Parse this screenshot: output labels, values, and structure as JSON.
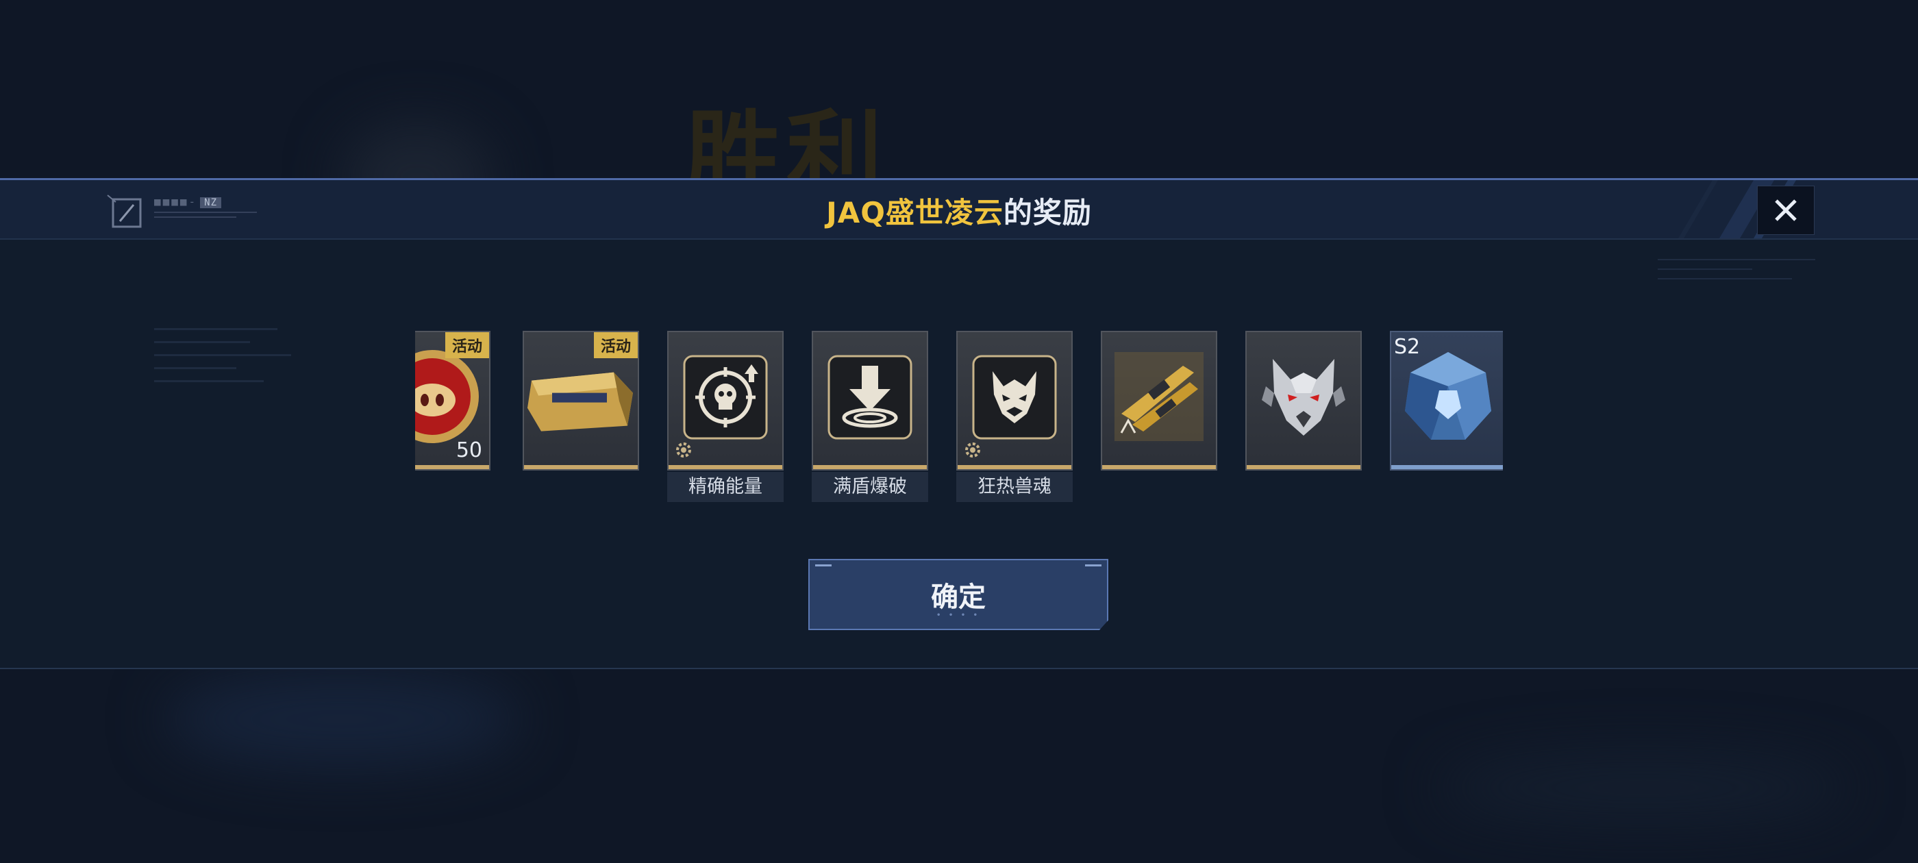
{
  "background": {
    "title": "胜利"
  },
  "modal": {
    "title_highlight": "JAQ盛世凌云",
    "title_rest": "的奖励",
    "deco_tag": "NZ"
  },
  "rewards": [
    {
      "id": "coin",
      "badge": "活动",
      "count": "50",
      "name": "",
      "icon": "pig-coin-icon"
    },
    {
      "id": "crate",
      "badge": "活动",
      "count": "",
      "name": "",
      "icon": "gold-crate-icon"
    },
    {
      "id": "precision",
      "badge": "",
      "count": "",
      "name": "精确能量",
      "icon": "skull-target-icon"
    },
    {
      "id": "shield",
      "badge": "",
      "count": "",
      "name": "满盾爆破",
      "icon": "shield-burst-icon"
    },
    {
      "id": "frenzy",
      "badge": "",
      "count": "",
      "name": "狂热兽魂",
      "icon": "beast-soul-icon"
    },
    {
      "id": "weapon",
      "badge": "",
      "count": "",
      "name": "",
      "icon": "gold-weapon-icon"
    },
    {
      "id": "wolf",
      "badge": "",
      "count": "",
      "name": "",
      "icon": "wolf-head-icon"
    },
    {
      "id": "gem",
      "badge": "",
      "count": "",
      "name": "",
      "icon": "blue-crystal-icon",
      "season": "S2"
    }
  ],
  "confirm_label": "确定",
  "colors": {
    "accent_gold": "#f1c43e",
    "border_blue": "#4f6aa6",
    "badge_gold": "#d8b34c"
  }
}
